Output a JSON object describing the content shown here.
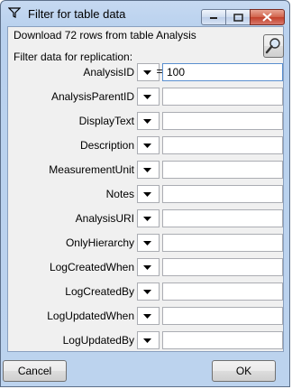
{
  "window": {
    "title": "Filter for table data"
  },
  "header": {
    "download_text": "Download 72 rows from table Analysis",
    "filter_label": "Filter data for replication:"
  },
  "filters": [
    {
      "label": "AnalysisID",
      "operator": "=",
      "value": "100"
    },
    {
      "label": "AnalysisParentID",
      "operator": "",
      "value": ""
    },
    {
      "label": "DisplayText",
      "operator": "",
      "value": ""
    },
    {
      "label": "Description",
      "operator": "",
      "value": ""
    },
    {
      "label": "MeasurementUnit",
      "operator": "",
      "value": ""
    },
    {
      "label": "Notes",
      "operator": "",
      "value": ""
    },
    {
      "label": "AnalysisURI",
      "operator": "",
      "value": ""
    },
    {
      "label": "OnlyHierarchy",
      "operator": "",
      "value": ""
    },
    {
      "label": "LogCreatedWhen",
      "operator": "",
      "value": ""
    },
    {
      "label": "LogCreatedBy",
      "operator": "",
      "value": ""
    },
    {
      "label": "LogUpdatedWhen",
      "operator": "",
      "value": ""
    },
    {
      "label": "LogUpdatedBy",
      "operator": "",
      "value": ""
    }
  ],
  "buttons": {
    "cancel": "Cancel",
    "ok": "OK"
  }
}
